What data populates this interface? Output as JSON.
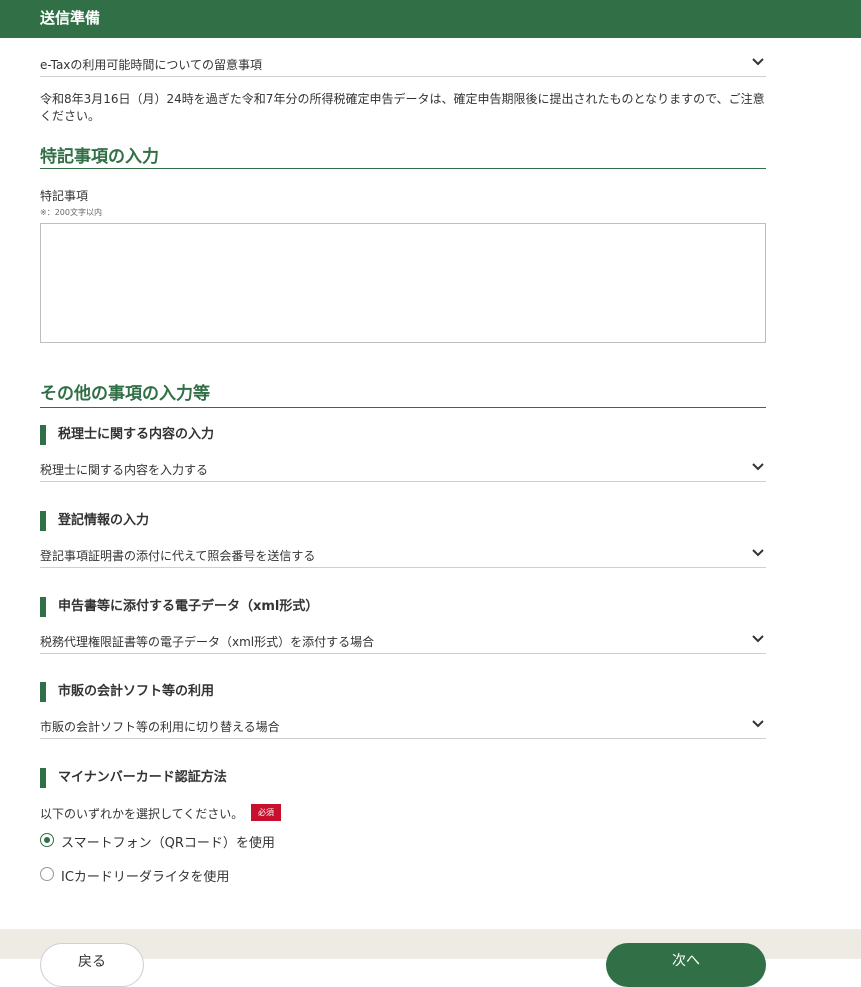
{
  "header": {
    "title": "送信準備"
  },
  "notice_accordion": {
    "label": "e-Taxの利用可能時間についての留意事項"
  },
  "notice_text": "令和8年3月16日（月）24時を過ぎた令和7年分の所得税確定申告データは、確定申告期限後に提出されたものとなりますので、ご注意ください。",
  "special_section": {
    "title": "特記事項の入力",
    "field_label": "特記事項",
    "field_note": "※：200文字以内",
    "value": ""
  },
  "other_section": {
    "title": "その他の事項の入力等",
    "groups": [
      {
        "title": "税理士に関する内容の入力",
        "accordion": "税理士に関する内容を入力する"
      },
      {
        "title": "登記情報の入力",
        "accordion": "登記事項証明書の添付に代えて照会番号を送信する"
      },
      {
        "title": "申告書等に添付する電子データ（xml形式）",
        "accordion": "税務代理権限証書等の電子データ（xml形式）を添付する場合"
      },
      {
        "title": "市販の会計ソフト等の利用",
        "accordion": "市販の会計ソフト等の利用に切り替える場合"
      }
    ]
  },
  "mynumber_section": {
    "title": "マイナンバーカード認証方法",
    "prompt": "以下のいずれかを選択してください。",
    "required_badge": "必須",
    "options": [
      {
        "label": "スマートフォン（QRコード）を使用",
        "selected": true
      },
      {
        "label": "ICカードリーダライタを使用",
        "selected": false
      }
    ]
  },
  "footer": {
    "back_label": "戻る",
    "next_label": "次へ"
  },
  "colors": {
    "brand_green": "#317046",
    "required_red": "#c8102e",
    "footer_bg": "#eeebe4"
  }
}
